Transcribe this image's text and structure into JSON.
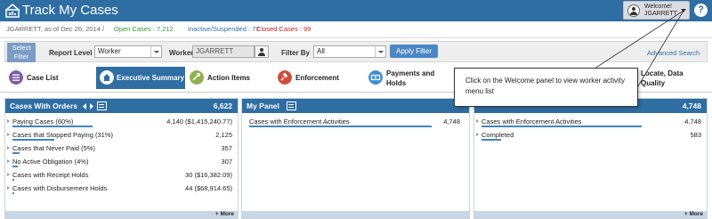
{
  "header": {
    "title": "Track My Cases",
    "welcome_label": "Welcome!",
    "welcome_user": "JGARRETT",
    "help_label": "?"
  },
  "status": {
    "as_of": "JGARRETT, as of Dec 26, 2014 /",
    "open_cases": "Open Cases : 7,212",
    "inactive": "Inactive/Suspended : 77",
    "closed": "Closed Cases : 99"
  },
  "filters": {
    "select_filter_line1": "Select",
    "select_filter_line2": "Filter",
    "report_level_label": "Report Level",
    "report_level_value": "Worker",
    "worker_label": "Worker",
    "worker_value": "JGARRETT",
    "filter_by_label": "Filter By",
    "filter_by_value": "All",
    "apply_label": "Apply Filter",
    "advanced_label": "Advanced Search"
  },
  "tabs": [
    {
      "label": "Case List",
      "color": "#7b5ea7"
    },
    {
      "label": "Executive Summary",
      "color": "#2f6ea3"
    },
    {
      "label": "Action Items",
      "color": "#8db14e"
    },
    {
      "label": "Enforcement",
      "color": "#d24b3b"
    },
    {
      "label_line1": "Payments and",
      "label_line2": "Holds",
      "color": "#3f8ed3"
    },
    {
      "label_line1": "Locate, Data",
      "label_line2": "Quality",
      "color": "#e1a640"
    }
  ],
  "callout": {
    "text": "Click on the Welcome panel to view worker activity menu list"
  },
  "panels": {
    "orders": {
      "title": "Cases With Orders",
      "count": "6,622",
      "more": "+ More",
      "rows": [
        {
          "label": "Paying Cases (60%)",
          "value": "4,140 ($1,415,240.77)",
          "fill": 0.6
        },
        {
          "label": "Cases that Stopped Paying (31%)",
          "value": "2,125",
          "fill": 0.31
        },
        {
          "label": "Cases that Never Paid (5%)",
          "value": "357",
          "fill": 0.05
        },
        {
          "label": "No Active Obligation (4%)",
          "value": "307",
          "fill": 0.04
        },
        {
          "label": "Cases with Receipt Holds",
          "value": "30 ($16,382.09)",
          "fill": 0.01
        },
        {
          "label": "Cases with Disbursement Holds",
          "value": "44 ($68,914.65)",
          "fill": 0.01
        }
      ]
    },
    "mypanel": {
      "title": "My Panel",
      "rows": [
        {
          "label": "Cases with Enforcement Activities",
          "value": "4,748",
          "fill": 1.0
        }
      ]
    },
    "third": {
      "count": "4,748",
      "more": "+ More",
      "rows": [
        {
          "label": "Cases with Enforcement Activities",
          "value": "4,748",
          "fill": 1.0
        },
        {
          "label": "Completed",
          "value": "583",
          "fill": 0.12
        }
      ]
    }
  }
}
